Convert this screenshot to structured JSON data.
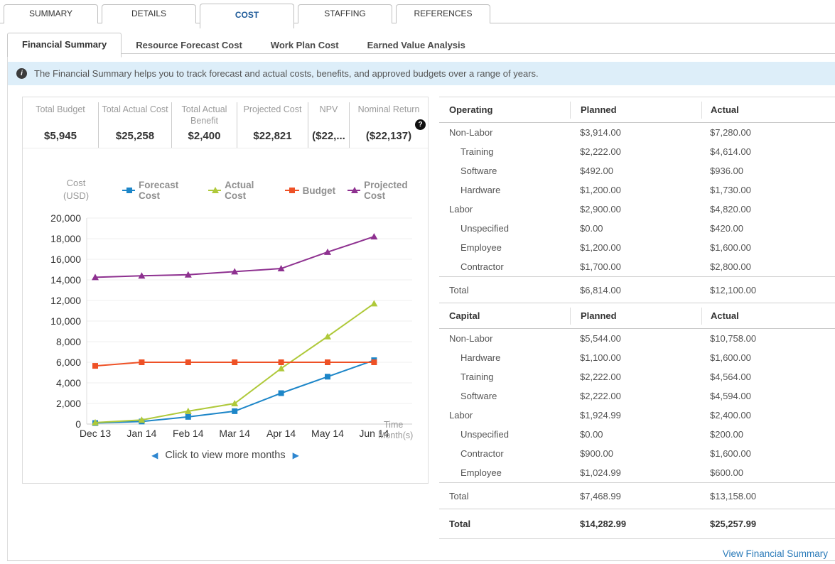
{
  "main_tabs": {
    "items": [
      {
        "label": "SUMMARY",
        "active": false
      },
      {
        "label": "DETAILS",
        "active": false
      },
      {
        "label": "COST",
        "active": true
      },
      {
        "label": "STAFFING",
        "active": false
      },
      {
        "label": "REFERENCES",
        "active": false
      }
    ]
  },
  "sub_tabs": {
    "items": [
      {
        "label": "Financial Summary",
        "active": true
      },
      {
        "label": "Resource Forecast Cost",
        "active": false
      },
      {
        "label": "Work Plan Cost",
        "active": false
      },
      {
        "label": "Earned Value Analysis",
        "active": false
      }
    ]
  },
  "info_banner": {
    "icon": "info-circle",
    "text": "The Financial Summary helps you to track forecast and actual costs, benefits, and approved budgets over a range of years."
  },
  "summary_stats": {
    "items": [
      {
        "label": "Total Budget",
        "value": "$5,945"
      },
      {
        "label": "Total Actual Cost",
        "value": "$25,258"
      },
      {
        "label": "Total Actual Benefit",
        "value": "$2,400"
      },
      {
        "label": "Projected Cost",
        "value": "$22,821"
      },
      {
        "label": "NPV",
        "value": "($22,..."
      },
      {
        "label": "Nominal Return",
        "value": "($22,137)",
        "help_icon": "question-circle"
      }
    ]
  },
  "chart": {
    "ylabel_line1": "Cost",
    "ylabel_line2": "(USD)",
    "xlabel_line1": "Time",
    "xlabel_line2": "Month(s)",
    "pager_prev": "◀",
    "pager_text": "Click to view more months",
    "pager_next": "▶"
  },
  "chart_data": {
    "type": "line",
    "title": "",
    "ylabel": "Cost (USD)",
    "xlabel": "Time Month(s)",
    "categories": [
      "Dec 13",
      "Jan 14",
      "Feb 14",
      "Mar 14",
      "Apr 14",
      "May 14",
      "Jun 14"
    ],
    "ylim": [
      0,
      20000
    ],
    "ytick_step": 2000,
    "grid": true,
    "legend_position": "top",
    "series": [
      {
        "name": "Forecast Cost",
        "color": "#1d86c8",
        "marker": "square",
        "values": [
          100,
          250,
          700,
          1250,
          3000,
          4600,
          6200
        ]
      },
      {
        "name": "Actual Cost",
        "color": "#afc93a",
        "marker": "triangle",
        "values": [
          150,
          400,
          1250,
          2000,
          5400,
          8500,
          11700
        ]
      },
      {
        "name": "Budget",
        "color": "#ee5126",
        "marker": "square",
        "values": [
          5650,
          6000,
          6000,
          6000,
          6000,
          6000,
          6000
        ]
      },
      {
        "name": "Projected Cost",
        "color": "#8e3190",
        "marker": "triangle",
        "values": [
          14250,
          14400,
          14500,
          14800,
          15100,
          16700,
          18200
        ]
      }
    ]
  },
  "cost_table": {
    "sections": [
      {
        "header": {
          "category": "Operating",
          "planned": "Planned",
          "actual": "Actual"
        },
        "rows": [
          {
            "label": "Non-Labor",
            "indent": 0,
            "planned": "$3,914.00",
            "actual": "$7,280.00"
          },
          {
            "label": "Training",
            "indent": 1,
            "planned": "$2,222.00",
            "actual": "$4,614.00"
          },
          {
            "label": "Software",
            "indent": 1,
            "planned": "$492.00",
            "actual": "$936.00"
          },
          {
            "label": "Hardware",
            "indent": 1,
            "planned": "$1,200.00",
            "actual": "$1,730.00"
          },
          {
            "label": "Labor",
            "indent": 0,
            "planned": "$2,900.00",
            "actual": "$4,820.00"
          },
          {
            "label": "Unspecified",
            "indent": 1,
            "planned": "$0.00",
            "actual": "$420.00"
          },
          {
            "label": "Employee",
            "indent": 1,
            "planned": "$1,200.00",
            "actual": "$1,600.00"
          },
          {
            "label": "Contractor",
            "indent": 1,
            "planned": "$1,700.00",
            "actual": "$2,800.00"
          }
        ],
        "total": {
          "label": "Total",
          "planned": "$6,814.00",
          "actual": "$12,100.00"
        }
      },
      {
        "header": {
          "category": "Capital",
          "planned": "Planned",
          "actual": "Actual"
        },
        "rows": [
          {
            "label": "Non-Labor",
            "indent": 0,
            "planned": "$5,544.00",
            "actual": "$10,758.00"
          },
          {
            "label": "Hardware",
            "indent": 1,
            "planned": "$1,100.00",
            "actual": "$1,600.00"
          },
          {
            "label": "Training",
            "indent": 1,
            "planned": "$2,222.00",
            "actual": "$4,564.00"
          },
          {
            "label": "Software",
            "indent": 1,
            "planned": "$2,222.00",
            "actual": "$4,594.00"
          },
          {
            "label": "Labor",
            "indent": 0,
            "planned": "$1,924.99",
            "actual": "$2,400.00"
          },
          {
            "label": "Unspecified",
            "indent": 1,
            "planned": "$0.00",
            "actual": "$200.00"
          },
          {
            "label": "Contractor",
            "indent": 1,
            "planned": "$900.00",
            "actual": "$1,600.00"
          },
          {
            "label": "Employee",
            "indent": 1,
            "planned": "$1,024.99",
            "actual": "$600.00"
          }
        ],
        "total": {
          "label": "Total",
          "planned": "$7,468.99",
          "actual": "$13,158.00"
        }
      }
    ],
    "grand_total": {
      "label": "Total",
      "planned": "$14,282.99",
      "actual": "$25,257.99"
    }
  },
  "footer": {
    "link_label": "View Financial Summary"
  },
  "colors": {
    "active_tab_text": "#1f5b99",
    "banner_bg": "#ddeef9",
    "link_blue": "#2b7bb9",
    "pager_arrow_blue": "#2e86d0",
    "grid_line": "#efefef",
    "axis_line": "#cccccc"
  }
}
